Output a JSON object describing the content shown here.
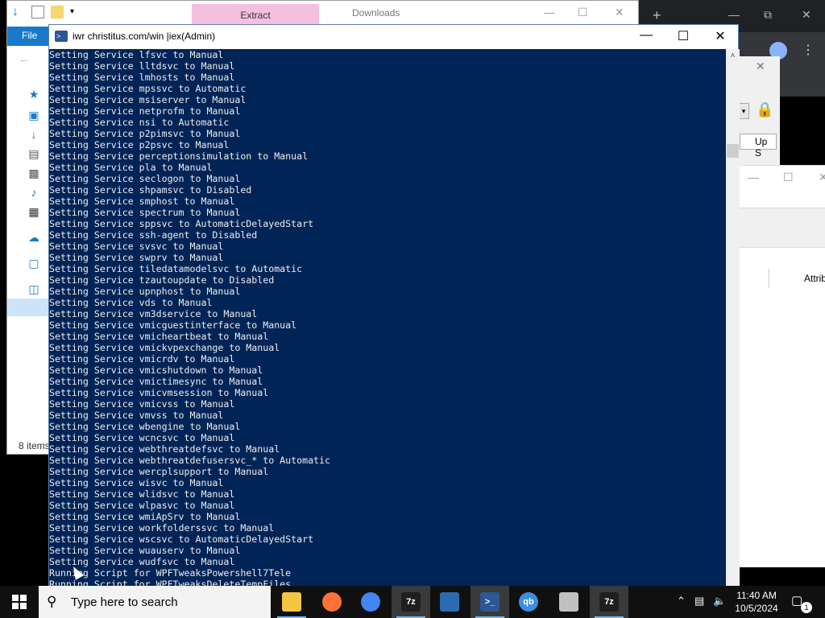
{
  "explorer": {
    "extract_tab": "Extract",
    "title": "Downloads",
    "file_tab": "File",
    "status": "8 items"
  },
  "right_bg": {
    "up_button": "Up S",
    "column_header": "Attrib"
  },
  "powershell": {
    "title": "iwr christitus.com/win |iex(Admin)",
    "lines": [
      "Setting Service lfsvc to Manual",
      "Setting Service lltdsvc to Manual",
      "Setting Service lmhosts to Manual",
      "Setting Service mpssvc to Automatic",
      "Setting Service msiserver to Manual",
      "Setting Service netprofm to Manual",
      "Setting Service nsi to Automatic",
      "Setting Service p2pimsvc to Manual",
      "Setting Service p2psvc to Manual",
      "Setting Service perceptionsimulation to Manual",
      "Setting Service pla to Manual",
      "Setting Service seclogon to Manual",
      "Setting Service shpamsvc to Disabled",
      "Setting Service smphost to Manual",
      "Setting Service spectrum to Manual",
      "Setting Service sppsvc to AutomaticDelayedStart",
      "Setting Service ssh-agent to Disabled",
      "Setting Service svsvc to Manual",
      "Setting Service swprv to Manual",
      "Setting Service tiledatamodelsvc to Automatic",
      "Setting Service tzautoupdate to Disabled",
      "Setting Service upnphost to Manual",
      "Setting Service vds to Manual",
      "Setting Service vm3dservice to Manual",
      "Setting Service vmicguestinterface to Manual",
      "Setting Service vmicheartbeat to Manual",
      "Setting Service vmickvpexchange to Manual",
      "Setting Service vmicrdv to Manual",
      "Setting Service vmicshutdown to Manual",
      "Setting Service vmictimesync to Manual",
      "Setting Service vmicvmsession to Manual",
      "Setting Service vmicvss to Manual",
      "Setting Service vmvss to Manual",
      "Setting Service wbengine to Manual",
      "Setting Service wcncsvc to Manual",
      "Setting Service webthreatdefsvc to Manual",
      "Setting Service webthreatdefusersvc_* to Automatic",
      "Setting Service wercplsupport to Manual",
      "Setting Service wisvc to Manual",
      "Setting Service wlidsvc to Manual",
      "Setting Service wlpasvc to Manual",
      "Setting Service wmiApSrv to Manual",
      "Setting Service workfolderssvc to Manual",
      "Setting Service wscsvc to AutomaticDelayedStart",
      "Setting Service wuauserv to Manual",
      "Setting Service wudfsvc to Manual",
      "Running Script for WPFTweaksPowershell7Tele",
      "Running Script for WPFTweaksDeleteTempFiles"
    ]
  },
  "taskbar": {
    "search_placeholder": "Type here to search",
    "time": "11:40 AM",
    "date": "10/5/2024",
    "notification_count": "1",
    "apps": [
      {
        "name": "file-explorer",
        "label": "",
        "color": "#f4c542"
      },
      {
        "name": "firefox",
        "label": "",
        "color": "#ff7139"
      },
      {
        "name": "chrome",
        "label": "",
        "color": "#4285f4"
      },
      {
        "name": "7zip",
        "label": "7z",
        "color": "#1f1f1f"
      },
      {
        "name": "network-tool",
        "label": "",
        "color": "#2b6cb0"
      },
      {
        "name": "powershell",
        "label": ">_",
        "color": "#2b5797"
      },
      {
        "name": "qbittorrent",
        "label": "qb",
        "color": "#3b8fe0"
      },
      {
        "name": "archive-tool",
        "label": "",
        "color": "#c0c0c0"
      },
      {
        "name": "7zip-2",
        "label": "7z",
        "color": "#1f1f1f"
      }
    ]
  }
}
